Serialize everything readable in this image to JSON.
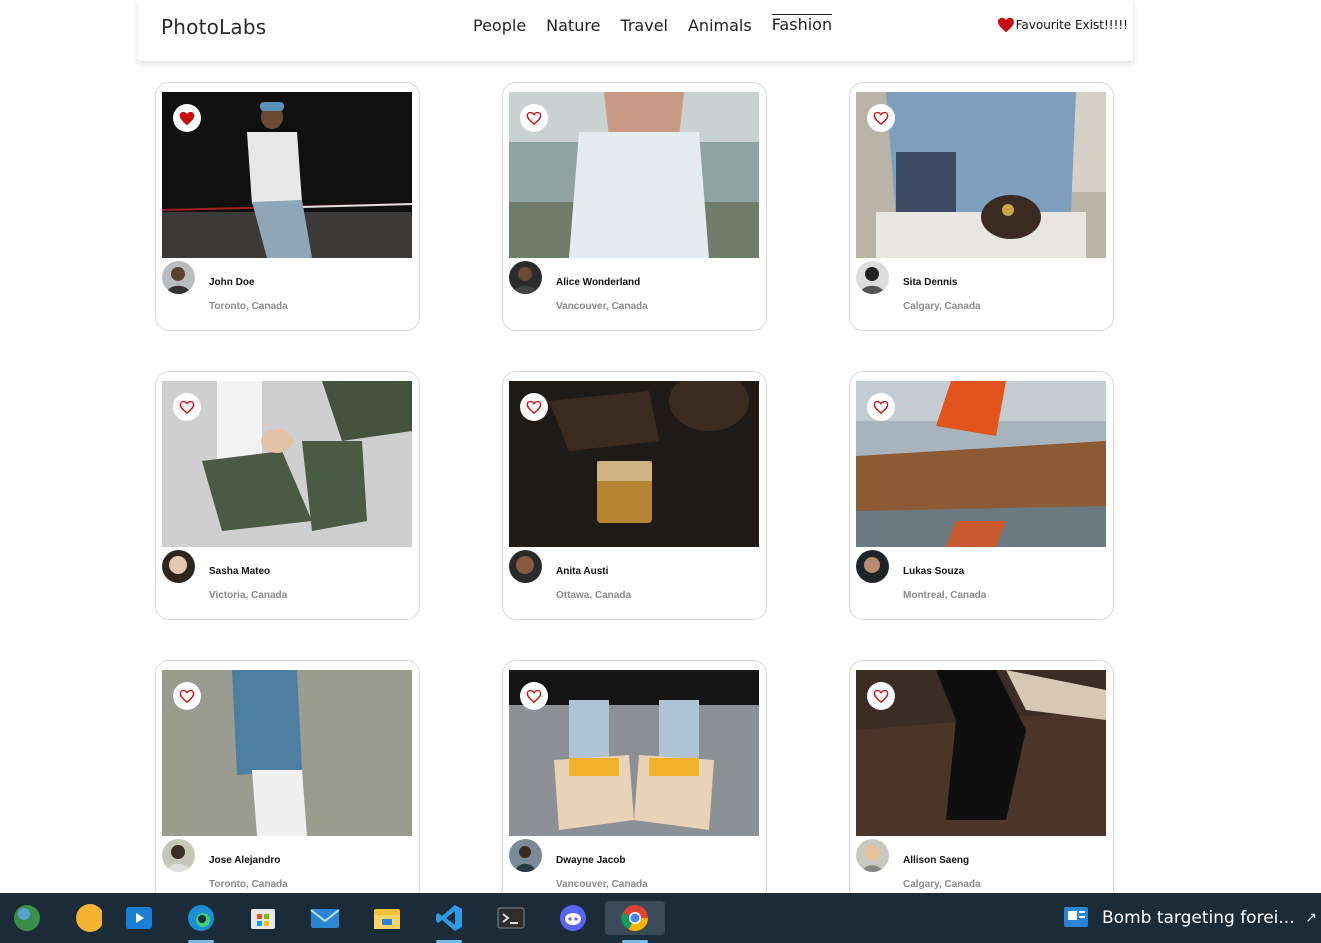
{
  "app": {
    "logo": "PhotoLabs",
    "favourite_text": "Favourite Exist!!!!!"
  },
  "topics": [
    {
      "label": "People",
      "active": false
    },
    {
      "label": "Nature",
      "active": false
    },
    {
      "label": "Travel",
      "active": false
    },
    {
      "label": "Animals",
      "active": false
    },
    {
      "label": "Fashion",
      "active": true
    }
  ],
  "photos": [
    {
      "name": "John Doe",
      "location": "Toronto, Canada",
      "liked": true
    },
    {
      "name": "Alice Wonderland",
      "location": "Vancouver, Canada",
      "liked": false
    },
    {
      "name": "Sita Dennis",
      "location": "Calgary, Canada",
      "liked": false
    },
    {
      "name": "Sasha Mateo",
      "location": "Victoria, Canada",
      "liked": false
    },
    {
      "name": "Anita Austi",
      "location": "Ottawa, Canada",
      "liked": false
    },
    {
      "name": "Lukas Souza",
      "location": "Montreal, Canada",
      "liked": false
    },
    {
      "name": "Jose Alejandro",
      "location": "Toronto, Canada",
      "liked": false
    },
    {
      "name": "Dwayne Jacob",
      "location": "Vancouver, Canada",
      "liked": false
    },
    {
      "name": "Allison Saeng",
      "location": "Calgary, Canada",
      "liked": false
    }
  ],
  "taskbar": {
    "apps": [
      "widgets",
      "media-player",
      "edge",
      "microsoft-store",
      "mail",
      "file-explorer",
      "vscode",
      "terminal",
      "discord",
      "chrome"
    ],
    "news_text": "Bomb targeting forei..."
  },
  "colors": {
    "accent_red": "#c80d0d",
    "taskbar_bg": "#1c2b38"
  }
}
